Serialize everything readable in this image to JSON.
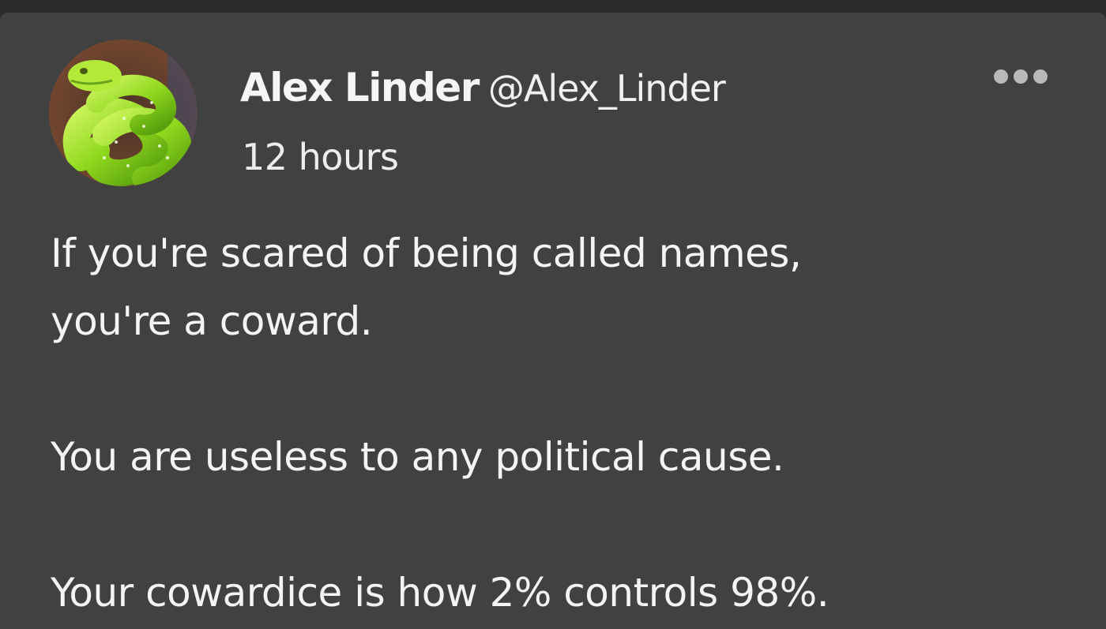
{
  "tweet": {
    "author": {
      "display_name": "Alex Linder",
      "handle": "@Alex_Linder",
      "avatar_icon": "green-snake-avatar"
    },
    "timestamp": "12 hours",
    "more_icon": "more-dots-icon",
    "body": {
      "paragraph_1_line_1": "If you're scared of being called names,",
      "paragraph_1_line_2": "you're a coward.",
      "paragraph_2": "You are useless to any political cause.",
      "paragraph_3": "Your cowardice is how 2% controls 98%."
    }
  },
  "colors": {
    "background": "#2c2c2c",
    "card": "#414141",
    "text": "#f2f2f2",
    "icon": "#b9b9b9"
  }
}
